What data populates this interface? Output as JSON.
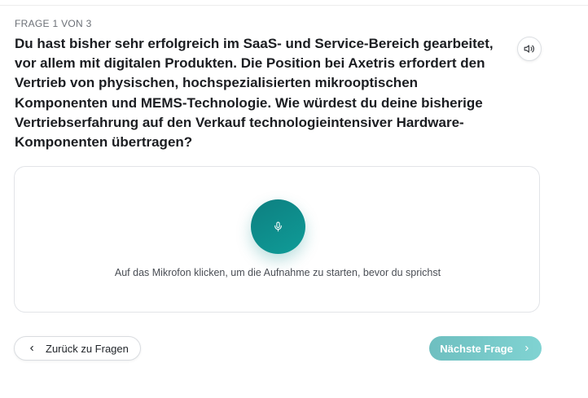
{
  "question": {
    "counter": "FRAGE 1 VON 3",
    "text": "Du hast bisher sehr erfolgreich im SaaS- und Service-Bereich gearbeitet, vor allem mit digitalen Produkten. Die Position bei Axetris erfordert den Vertrieb von physischen, hochspezialisierten mikrooptischen Komponenten und MEMS-Technologie. Wie würdest du deine bisherige Vertriebserfahrung auf den Verkauf technologieintensiver Hardware-Komponenten übertragen?",
    "speaker_icon": "speaker-icon"
  },
  "recorder": {
    "mic_icon": "microphone-icon",
    "hint": "Auf das Mikrofon klicken, um die Aufnahme zu starten, bevor du sprichst",
    "accent_color": "#0f9c98"
  },
  "navigation": {
    "back_label": "Zurück zu Fragen",
    "back_icon": "chevron-left-icon",
    "next_label": "Nächste Frage",
    "next_icon": "chevron-right-icon",
    "next_color": "#7fd0cf"
  }
}
